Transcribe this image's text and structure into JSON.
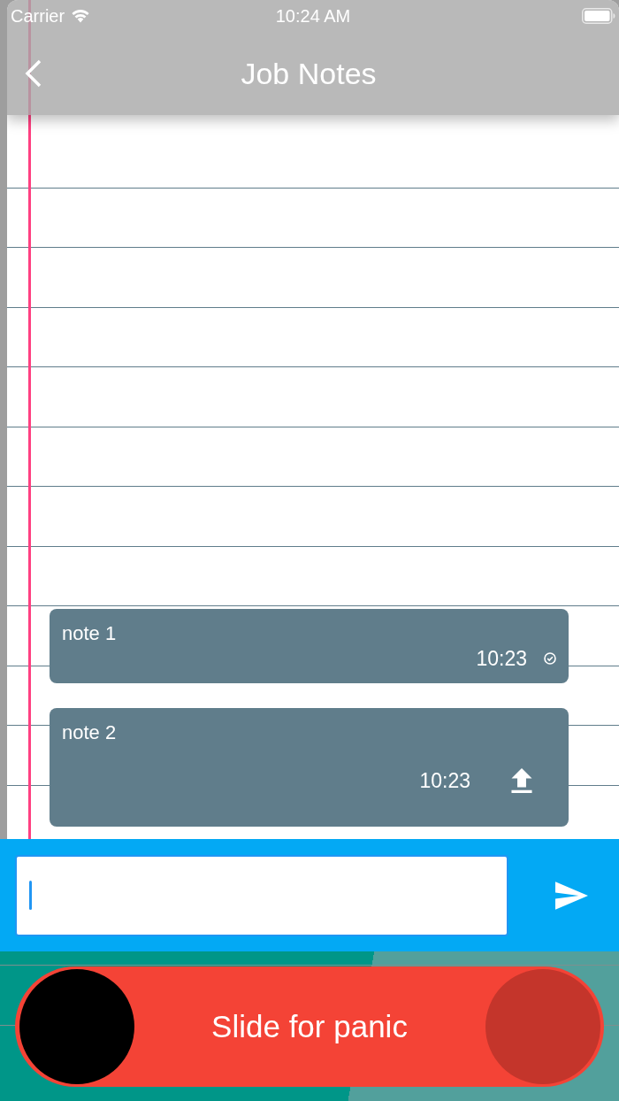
{
  "status_bar": {
    "carrier": "Carrier",
    "time": "10:24 AM"
  },
  "nav_bar": {
    "title": "Job Notes"
  },
  "notes": [
    {
      "text": "note 1",
      "time": "10:23",
      "synced": true
    },
    {
      "text": "note 2",
      "time": "10:23",
      "synced": false
    }
  ],
  "composer": {
    "focused": true
  },
  "panic_slider": {
    "label": "Slide for panic",
    "level": 0
  }
}
